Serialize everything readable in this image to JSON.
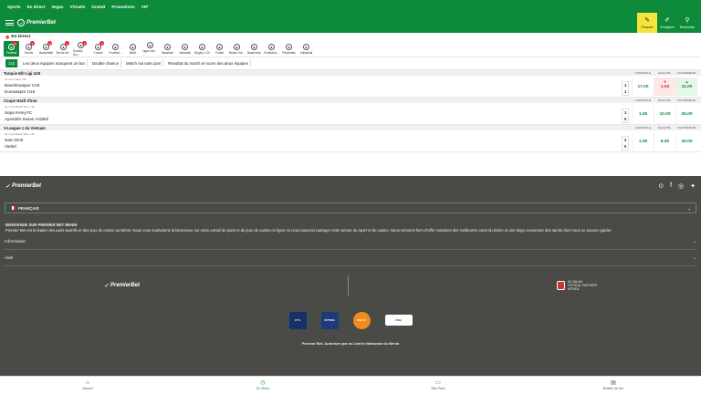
{
  "topnav": [
    "Sports",
    "En direct",
    "Vegas",
    "Virtuels",
    "Gratuit",
    "Promotions",
    "VIP"
  ],
  "brand": "PremierBet",
  "header_actions": [
    {
      "label": "S'inscrire",
      "icon": "pencil-icon",
      "active": true
    },
    {
      "label": "Enregistrer",
      "icon": "pencil-outline-icon",
      "active": false
    },
    {
      "label": "Rechercher",
      "icon": "search-icon",
      "active": false
    }
  ],
  "live_title": "En Direct",
  "sports": [
    {
      "label": "Football",
      "count": "6",
      "active": true
    },
    {
      "label": "Tennis",
      "count": "5"
    },
    {
      "label": "Basketball",
      "count": "14"
    },
    {
      "label": "Tennis De...",
      "count": "7"
    },
    {
      "label": "Hockey Sur...",
      "count": "4"
    },
    {
      "label": "Cricket",
      "count": "3"
    },
    {
      "label": "Football..."
    },
    {
      "label": "MMA"
    },
    {
      "label": "Ligue des ..."
    },
    {
      "label": "Baseball"
    },
    {
      "label": "Handball"
    },
    {
      "label": "Rugby L.XV"
    },
    {
      "label": "Futsal"
    },
    {
      "label": "Beach Vol..."
    },
    {
      "label": "Badminton"
    },
    {
      "label": "Football A..."
    },
    {
      "label": "Fléchettes"
    },
    {
      "label": "Volleyball"
    }
  ],
  "markets": [
    "1x2",
    "Les deux équipes marquent un but",
    "Double chance",
    "Match nul sans pari",
    "Résultat du match et score des deux équipes"
  ],
  "columns": [
    "1 DOMICILE",
    "ÉGALITÉ",
    "2 EXTÉRIEUR"
  ],
  "leagues": [
    {
      "name": "Turquie Elit Ligi U19",
      "matches": [
        {
          "meta": "2è mi-te  Sem  • 82",
          "team1": "Bandirmaspor U19",
          "team2": "Eurosaspor U19",
          "score1": "1",
          "score2": "1",
          "odds": [
            "17.00",
            "1.04",
            "11.00"
          ],
          "trend": [
            "none",
            "down",
            "up"
          ]
        }
      ]
    },
    {
      "name": "Coupe Hazfi d'Iran",
      "matches": [
        {
          "meta": "2è mi-te  Break Time  • 94",
          "team1": "Sepa Kerej FC",
          "team2": "Ayandeh Sazan Ardabil",
          "score1": "1",
          "score2": "0",
          "odds": [
            "1.05",
            "10.00",
            "25.00"
          ],
          "trend": [
            "none",
            "none",
            "none"
          ]
        }
      ]
    },
    {
      "name": "V-League 1 du Vietnam",
      "matches": [
        {
          "meta": "2è mi-te  Break Time  • 80",
          "team1": "Nam Dinh",
          "team2": "Viettel",
          "score1": "2",
          "score2": "0",
          "odds": [
            "1.05",
            "9.00",
            "26.00"
          ],
          "trend": [
            "none",
            "none",
            "none"
          ]
        }
      ]
    }
  ],
  "footer": {
    "language": "FRANÇAIS",
    "welcome_title": "BIENVENUE SUR PREMIER BET BENIN",
    "welcome_text": "Premier Bet est le leader des paris sportifs et des jeux de casino au Bénin. Nous vous souhaitons la bienvenue sur notre portail de paris et de jeux de casino en ligne où nous pouvons partager notre amour du sport et du casino. Nous sommes fiers d'offrir certaines des meilleures cotes du Bénin et une large couverture des sports dont vous ne pouvez garder.",
    "accordions": [
      "Information",
      "Aide"
    ],
    "partner": "AC MILAN\nOFFICIAL PARTNER\nAFRICA",
    "payments": [
      "MTN",
      "OPTIMA",
      "MOOV",
      "VISA"
    ],
    "legal": "Premier Bet. Autorisée par la Loterie Nationale du Bénin"
  },
  "bottombar": [
    {
      "label": "Accueil",
      "icon": "home-icon"
    },
    {
      "label": "En Direct",
      "icon": "live-clock-icon",
      "active": true
    },
    {
      "label": "Mes Paris",
      "icon": "receipt-icon"
    },
    {
      "label": "Bulletin de Jeu",
      "icon": "betslip-icon"
    }
  ],
  "colors": {
    "brand": "#0d8a3a",
    "accent": "#f5e43a",
    "footer": "#4a4a47"
  }
}
